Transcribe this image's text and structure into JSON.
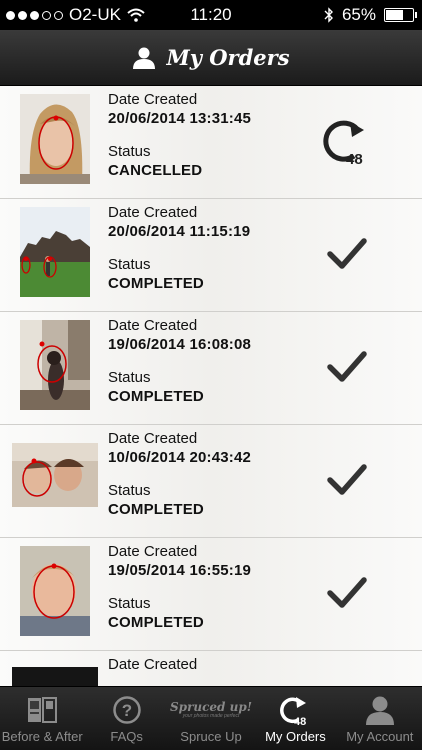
{
  "status_bar": {
    "carrier": "O2-UK",
    "time": "11:20",
    "battery_percent": "65%"
  },
  "header": {
    "title": "My Orders"
  },
  "labels": {
    "date_created": "Date Created",
    "status": "Status"
  },
  "orders": [
    {
      "date": "20/06/2014 13:31:45",
      "status": "CANCELLED",
      "status_icon": "refresh-48-icon",
      "icon_badge": "48"
    },
    {
      "date": "20/06/2014 11:15:19",
      "status": "COMPLETED",
      "status_icon": "checkmark-icon"
    },
    {
      "date": "19/06/2014 16:08:08",
      "status": "COMPLETED",
      "status_icon": "checkmark-icon"
    },
    {
      "date": "10/06/2014 20:43:42",
      "status": "COMPLETED",
      "status_icon": "checkmark-icon"
    },
    {
      "date": "19/05/2014 16:55:19",
      "status": "COMPLETED",
      "status_icon": "checkmark-icon"
    },
    {
      "date": "",
      "status": ""
    }
  ],
  "tabbar": {
    "tabs": [
      {
        "label": "Before & After",
        "icon": "before-after-icon"
      },
      {
        "label": "FAQs",
        "icon": "question-icon"
      },
      {
        "label": "Spruce Up",
        "icon": "spruced-up-logo",
        "brand": "Spruced up!",
        "brand_sub": "your photos made perfect"
      },
      {
        "label": "My Orders",
        "icon": "refresh-48-icon",
        "badge": "48",
        "active": true
      },
      {
        "label": "My Account",
        "icon": "user-icon"
      }
    ]
  }
}
